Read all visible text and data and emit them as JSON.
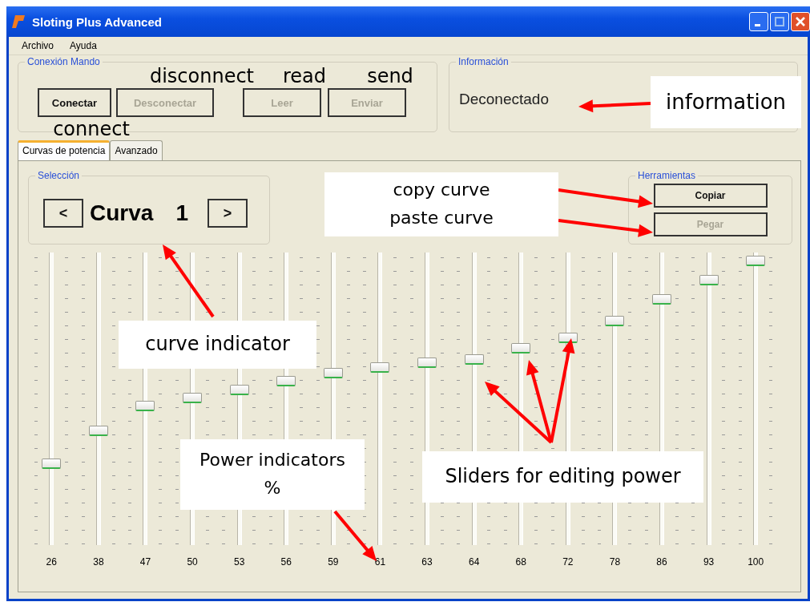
{
  "window": {
    "title": "Sloting Plus Advanced"
  },
  "menu": [
    "Archivo",
    "Ayuda"
  ],
  "connection_group": {
    "title": "Conexión Mando",
    "buttons": [
      {
        "label": "Conectar",
        "disabled": false
      },
      {
        "label": "Desconectar",
        "disabled": true
      },
      {
        "label": "Leer",
        "disabled": true
      },
      {
        "label": "Enviar",
        "disabled": true
      }
    ]
  },
  "info_group": {
    "title": "Información",
    "status": "Deconectado"
  },
  "tabs": [
    {
      "label": "Curvas de potencia",
      "selected": true
    },
    {
      "label": "Avanzado",
      "selected": false
    }
  ],
  "selection_group": {
    "title": "Selección",
    "prev": "<",
    "curve_label": "Curva",
    "curve_number": "1",
    "next": ">"
  },
  "tools_group": {
    "title": "Herramientas",
    "buttons": [
      {
        "label": "Copiar",
        "disabled": false
      },
      {
        "label": "Pegar",
        "disabled": true
      }
    ]
  },
  "sliders": [
    {
      "level": 0.26,
      "reading": "26"
    },
    {
      "level": 0.38,
      "reading": "38"
    },
    {
      "level": 0.47,
      "reading": "47"
    },
    {
      "level": 0.5,
      "reading": "50"
    },
    {
      "level": 0.53,
      "reading": "53"
    },
    {
      "level": 0.56,
      "reading": "56"
    },
    {
      "level": 0.59,
      "reading": "59"
    },
    {
      "level": 0.61,
      "reading": "61"
    },
    {
      "level": 0.63,
      "reading": "63"
    },
    {
      "level": 0.64,
      "reading": "64"
    },
    {
      "level": 0.68,
      "reading": "68"
    },
    {
      "level": 0.72,
      "reading": "72"
    },
    {
      "level": 0.78,
      "reading": "78"
    },
    {
      "level": 0.86,
      "reading": "86"
    },
    {
      "level": 0.93,
      "reading": "93"
    },
    {
      "level": 1.0,
      "reading": "100"
    }
  ],
  "annotations": [
    {
      "lines": [
        "disconnect"
      ],
      "boxed": false
    },
    {
      "lines": [
        "read"
      ],
      "boxed": false
    },
    {
      "lines": [
        "send"
      ],
      "boxed": false
    },
    {
      "lines": [
        "connect"
      ],
      "boxed": false
    },
    {
      "lines": [
        "information"
      ],
      "boxed": true
    },
    {
      "lines": [
        "copy curve",
        "paste curve"
      ],
      "boxed": true
    },
    {
      "lines": [
        "curve indicator"
      ],
      "boxed": true
    },
    {
      "lines": [
        "Power indicators",
        "%"
      ],
      "boxed": true
    },
    {
      "lines": [
        "Sliders for editing power"
      ],
      "boxed": true
    }
  ]
}
